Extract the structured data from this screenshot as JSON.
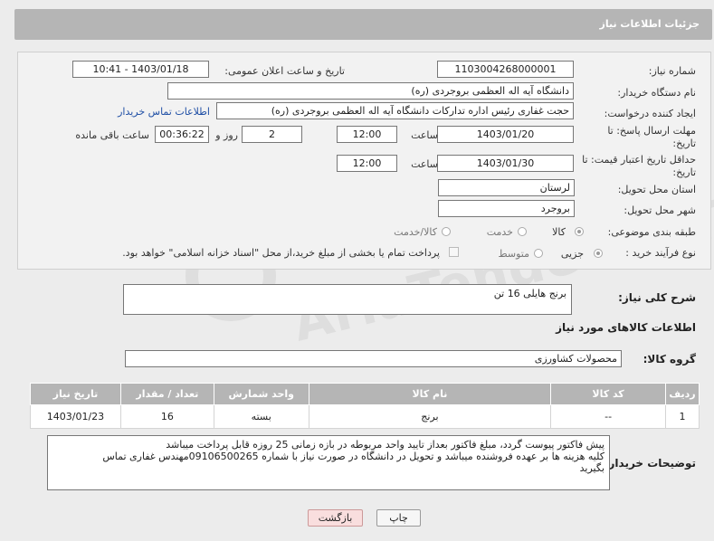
{
  "header": {
    "title": "جزئیات اطلاعات نیاز"
  },
  "form": {
    "need_number": {
      "label": "شماره نیاز:",
      "value": "1103004268000001"
    },
    "announce": {
      "label": "تاریخ و ساعت اعلان عمومی:",
      "value": "1403/01/18 - 10:41"
    },
    "buyer_org": {
      "label": "نام دستگاه خریدار:",
      "value": "دانشگاه آیه اله العظمی بروجردی (ره)"
    },
    "requester": {
      "label": "ایجاد کننده درخواست:",
      "value": "حجت غفاری رئیس اداره تدارکات  دانشگاه آیه اله العظمی بروجردی (ره)",
      "contact_link": "اطلاعات تماس خریدار"
    },
    "reply_deadline": {
      "label": "مهلت ارسال پاسخ: تا تاریخ:",
      "date": "1403/01/20",
      "time_label": "ساعت",
      "time": "12:00",
      "days": "2",
      "days_label": "روز و",
      "remaining": "00:36:22",
      "remaining_label": "ساعت باقی مانده"
    },
    "price_validity": {
      "label": "حداقل تاریخ اعتبار قیمت: تا تاریخ:",
      "date": "1403/01/30",
      "time_label": "ساعت",
      "time": "12:00"
    },
    "province": {
      "label": "استان محل تحویل:",
      "value": "لرستان"
    },
    "city": {
      "label": "شهر محل تحویل:",
      "value": "بروجرد"
    },
    "category": {
      "label": "طبقه بندی موضوعی:",
      "options": [
        "کالا",
        "خدمت",
        "کالا/خدمت"
      ]
    },
    "process": {
      "label": "نوع فرآیند خرید :",
      "options": [
        "جزیی",
        "متوسط"
      ],
      "payment_note": "پرداخت تمام یا بخشی از مبلغ خرید،از محل \"اسناد خزانه اسلامی\" خواهد بود."
    }
  },
  "summary": {
    "label": "شرح کلی نیاز:",
    "value": "برنج هایلی 16 تن"
  },
  "goods_section": {
    "title": "اطلاعات کالاهای مورد نیاز"
  },
  "goods_group": {
    "label": "گروه کالا:",
    "value": "محصولات کشاورزی"
  },
  "table": {
    "headers": [
      "ردیف",
      "کد کالا",
      "نام کالا",
      "واحد شمارش",
      "تعداد / مقدار",
      "تاریخ نیاز"
    ],
    "rows": [
      [
        "1",
        "--",
        "برنج",
        "بسته",
        "16",
        "1403/01/23"
      ]
    ]
  },
  "buyer_notes": {
    "label": "توضیحات خریدار:",
    "lines": [
      "پیش فاکتور پیوست گردد، مبلغ فاکتور بعداز تایید واحد مربوطه در بازه زمانی 25 روزه قابل پرداخت میباشد",
      "کلیه هزینه ها بر عهده فروشنده میباشد و تحویل در دانشگاه   در صورت نیاز با شماره 09106500265مهندس غفاری تماس",
      "بگیرید"
    ]
  },
  "buttons": {
    "print": "چاپ",
    "back": "بازگشت"
  },
  "watermark": "AriaTender.neT",
  "colors": {
    "header_bg": "#b5b5b5",
    "link": "#1f4fa5",
    "back_button_bg": "#f9dede"
  }
}
